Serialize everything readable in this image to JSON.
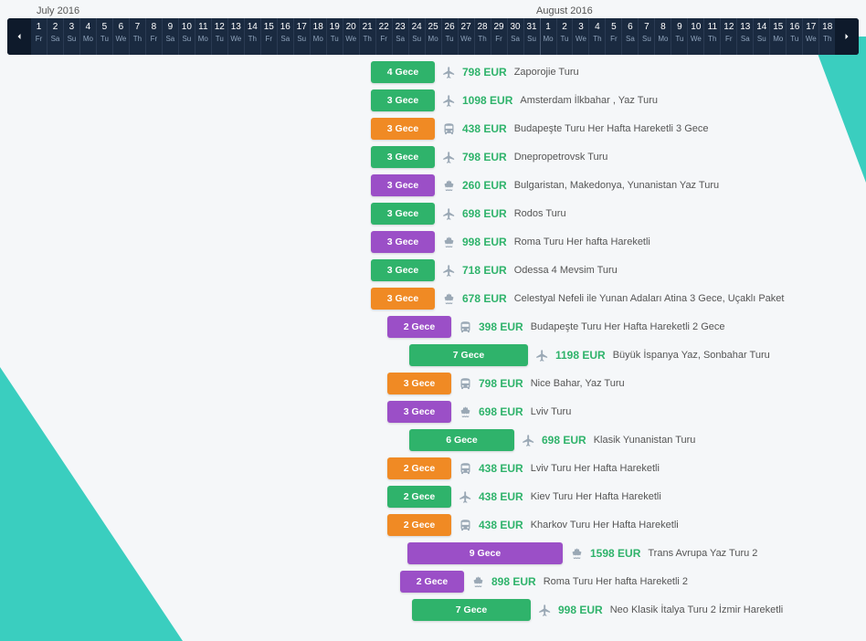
{
  "months": {
    "left": "July 2016",
    "right": "August 2016"
  },
  "days": [
    {
      "n": "1",
      "d": "Fr"
    },
    {
      "n": "2",
      "d": "Sa"
    },
    {
      "n": "3",
      "d": "Su"
    },
    {
      "n": "4",
      "d": "Mo"
    },
    {
      "n": "5",
      "d": "Tu"
    },
    {
      "n": "6",
      "d": "We"
    },
    {
      "n": "7",
      "d": "Th"
    },
    {
      "n": "8",
      "d": "Fr"
    },
    {
      "n": "9",
      "d": "Sa"
    },
    {
      "n": "10",
      "d": "Su"
    },
    {
      "n": "11",
      "d": "Mo"
    },
    {
      "n": "12",
      "d": "Tu"
    },
    {
      "n": "13",
      "d": "We"
    },
    {
      "n": "14",
      "d": "Th"
    },
    {
      "n": "15",
      "d": "Fr"
    },
    {
      "n": "16",
      "d": "Sa"
    },
    {
      "n": "17",
      "d": "Su"
    },
    {
      "n": "18",
      "d": "Mo"
    },
    {
      "n": "19",
      "d": "Tu"
    },
    {
      "n": "20",
      "d": "We"
    },
    {
      "n": "21",
      "d": "Th"
    },
    {
      "n": "22",
      "d": "Fr"
    },
    {
      "n": "23",
      "d": "Sa"
    },
    {
      "n": "24",
      "d": "Su"
    },
    {
      "n": "25",
      "d": "Mo"
    },
    {
      "n": "26",
      "d": "Tu"
    },
    {
      "n": "27",
      "d": "We"
    },
    {
      "n": "28",
      "d": "Th"
    },
    {
      "n": "29",
      "d": "Fr"
    },
    {
      "n": "30",
      "d": "Sa"
    },
    {
      "n": "31",
      "d": "Su"
    },
    {
      "n": "1",
      "d": "Mo"
    },
    {
      "n": "2",
      "d": "Tu"
    },
    {
      "n": "3",
      "d": "We"
    },
    {
      "n": "4",
      "d": "Th"
    },
    {
      "n": "5",
      "d": "Fr"
    },
    {
      "n": "6",
      "d": "Sa"
    },
    {
      "n": "7",
      "d": "Su"
    },
    {
      "n": "8",
      "d": "Mo"
    },
    {
      "n": "9",
      "d": "Tu"
    },
    {
      "n": "10",
      "d": "We"
    },
    {
      "n": "11",
      "d": "Th"
    },
    {
      "n": "12",
      "d": "Fr"
    },
    {
      "n": "13",
      "d": "Sa"
    },
    {
      "n": "14",
      "d": "Su"
    },
    {
      "n": "15",
      "d": "Mo"
    },
    {
      "n": "16",
      "d": "Tu"
    },
    {
      "n": "17",
      "d": "We"
    },
    {
      "n": "18",
      "d": "Th"
    }
  ],
  "tours": [
    {
      "offset": 370,
      "width": 70,
      "color": "green",
      "nights": "4 Gece",
      "icon": "plane",
      "price": "798 EUR",
      "title": "Zaporojie Turu"
    },
    {
      "offset": 370,
      "width": 70,
      "color": "green",
      "nights": "3 Gece",
      "icon": "plane",
      "price": "1098 EUR",
      "title": "Amsterdam İlkbahar , Yaz Turu"
    },
    {
      "offset": 370,
      "width": 70,
      "color": "orange",
      "nights": "3 Gece",
      "icon": "bus",
      "price": "438 EUR",
      "title": "Budapeşte Turu Her Hafta Hareketli 3 Gece"
    },
    {
      "offset": 370,
      "width": 70,
      "color": "green",
      "nights": "3 Gece",
      "icon": "plane",
      "price": "798 EUR",
      "title": "Dnepropetrovsk Turu"
    },
    {
      "offset": 370,
      "width": 70,
      "color": "purple",
      "nights": "3 Gece",
      "icon": "ship",
      "price": "260 EUR",
      "title": "Bulgaristan, Makedonya, Yunanistan Yaz Turu"
    },
    {
      "offset": 370,
      "width": 70,
      "color": "green",
      "nights": "3 Gece",
      "icon": "plane",
      "price": "698 EUR",
      "title": "Rodos Turu"
    },
    {
      "offset": 370,
      "width": 70,
      "color": "purple",
      "nights": "3 Gece",
      "icon": "ship",
      "price": "998 EUR",
      "title": "Roma Turu Her hafta Hareketli"
    },
    {
      "offset": 370,
      "width": 70,
      "color": "green",
      "nights": "3 Gece",
      "icon": "plane",
      "price": "718 EUR",
      "title": "Odessa 4 Mevsim Turu"
    },
    {
      "offset": 370,
      "width": 70,
      "color": "orange",
      "nights": "3 Gece",
      "icon": "ship",
      "price": "678 EUR",
      "title": "Celestyal Nefeli ile Yunan Adaları Atina 3 Gece, Uçaklı Paket"
    },
    {
      "offset": 388,
      "width": 70,
      "color": "purple",
      "nights": "2 Gece",
      "icon": "bus",
      "price": "398 EUR",
      "title": "Budapeşte Turu Her Hafta Hareketli 2 Gece"
    },
    {
      "offset": 412,
      "width": 130,
      "color": "green",
      "nights": "7 Gece",
      "icon": "plane",
      "price": "1198 EUR",
      "title": "Büyük İspanya Yaz, Sonbahar Turu"
    },
    {
      "offset": 388,
      "width": 70,
      "color": "orange",
      "nights": "3 Gece",
      "icon": "bus",
      "price": "798 EUR",
      "title": "Nice Bahar, Yaz Turu"
    },
    {
      "offset": 388,
      "width": 70,
      "color": "purple",
      "nights": "3 Gece",
      "icon": "ship",
      "price": "698 EUR",
      "title": "Lviv Turu"
    },
    {
      "offset": 412,
      "width": 115,
      "color": "green",
      "nights": "6 Gece",
      "icon": "plane",
      "price": "698 EUR",
      "title": "Klasik Yunanistan Turu"
    },
    {
      "offset": 388,
      "width": 70,
      "color": "orange",
      "nights": "2 Gece",
      "icon": "bus",
      "price": "438 EUR",
      "title": "Lviv Turu Her Hafta Hareketli"
    },
    {
      "offset": 388,
      "width": 70,
      "color": "green",
      "nights": "2 Gece",
      "icon": "plane",
      "price": "438 EUR",
      "title": "Kiev Turu Her Hafta Hareketli"
    },
    {
      "offset": 388,
      "width": 70,
      "color": "orange",
      "nights": "2 Gece",
      "icon": "bus",
      "price": "438 EUR",
      "title": "Kharkov Turu Her Hafta Hareketli"
    },
    {
      "offset": 410,
      "width": 170,
      "color": "purple",
      "nights": "9 Gece",
      "icon": "ship",
      "price": "1598 EUR",
      "title": "Trans Avrupa Yaz Turu 2"
    },
    {
      "offset": 402,
      "width": 70,
      "color": "purple",
      "nights": "2 Gece",
      "icon": "ship",
      "price": "898 EUR",
      "title": "Roma Turu Her hafta Hareketli 2"
    },
    {
      "offset": 415,
      "width": 130,
      "color": "green",
      "nights": "7 Gece",
      "icon": "plane",
      "price": "998 EUR",
      "title": "Neo Klasik İtalya Turu 2 İzmir Hareketli"
    }
  ]
}
